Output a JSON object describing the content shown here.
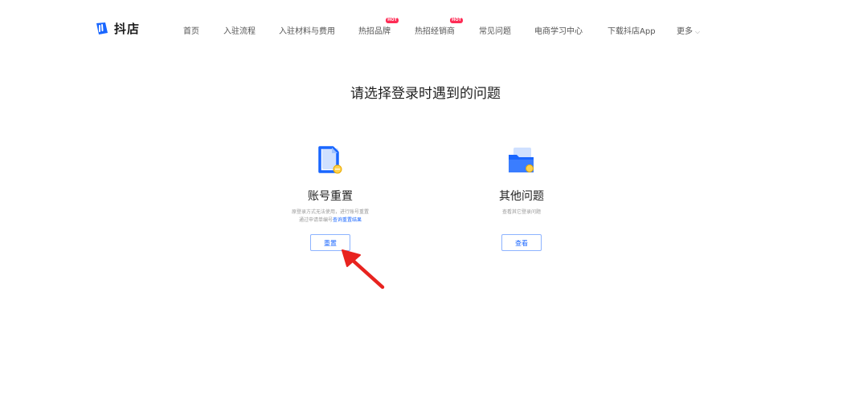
{
  "header": {
    "logo_text": "抖店",
    "nav": [
      {
        "label": "首页",
        "hot": ""
      },
      {
        "label": "入驻流程",
        "hot": ""
      },
      {
        "label": "入驻材料与费用",
        "hot": ""
      },
      {
        "label": "热招品牌",
        "hot": "HOT"
      },
      {
        "label": "热招经销商",
        "hot": "HOT"
      },
      {
        "label": "常见问题",
        "hot": ""
      },
      {
        "label": "电商学习中心",
        "hot": ""
      },
      {
        "label": "下载抖店App",
        "hot": ""
      },
      {
        "label": "更多",
        "hot": ""
      }
    ],
    "more_caret": "⌵"
  },
  "main": {
    "title": "请选择登录时遇到的问题",
    "cards": [
      {
        "title": "账号重置",
        "desc_line1": "原登录方式无法使用，进行账号重置",
        "desc_line2_prefix": "通过申请单编号",
        "desc_line2_link": "查询重置结果",
        "button": "重置"
      },
      {
        "title": "其他问题",
        "desc_line1": "查看其它登录问题",
        "button": "查看"
      }
    ]
  },
  "colors": {
    "brand_blue": "#1966ff",
    "hot_badge": "#fe2c55",
    "annotation_arrow": "#e8231f"
  },
  "icons": {
    "logo": "doudian-logo-icon",
    "reset_card": "document-pen-icon",
    "other_card": "folder-icon",
    "annotation": "red-arrow-icon"
  }
}
